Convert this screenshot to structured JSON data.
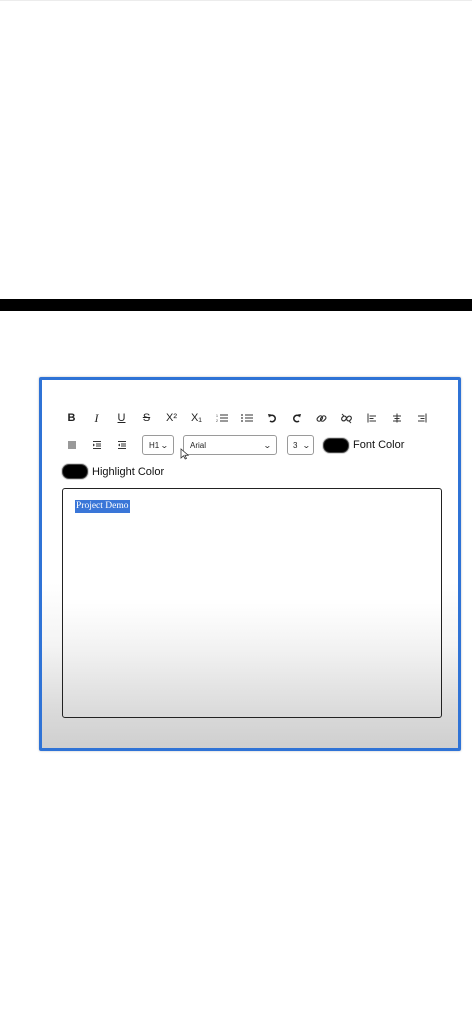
{
  "toolbar": {
    "row1": [
      {
        "name": "bold-button",
        "label": "B",
        "cls": "b"
      },
      {
        "name": "italic-button",
        "label": "I",
        "cls": "i"
      },
      {
        "name": "underline-button",
        "label": "U",
        "cls": "u"
      },
      {
        "name": "strikethrough-button",
        "label": "S",
        "cls": "s"
      },
      {
        "name": "superscript-button",
        "label": "X²"
      },
      {
        "name": "subscript-button",
        "label": "X₁"
      },
      {
        "name": "ordered-list-button",
        "icon": "ordered-list-icon"
      },
      {
        "name": "unordered-list-button",
        "icon": "unordered-list-icon"
      },
      {
        "name": "undo-button",
        "icon": "undo-icon"
      },
      {
        "name": "redo-button",
        "icon": "redo-icon"
      },
      {
        "name": "link-button",
        "icon": "link-icon"
      },
      {
        "name": "unlink-button",
        "icon": "unlink-icon"
      },
      {
        "name": "align-left-button",
        "icon": "align-left-icon"
      },
      {
        "name": "align-center-button",
        "icon": "align-center-icon"
      },
      {
        "name": "align-right-button",
        "icon": "align-right-icon"
      }
    ],
    "row2_buttons": [
      {
        "name": "justify-button",
        "icon": "justify-icon"
      },
      {
        "name": "indent-button",
        "icon": "indent-icon"
      },
      {
        "name": "outdent-button",
        "icon": "outdent-icon"
      }
    ],
    "heading_select": "H1",
    "font_select": "Arial",
    "size_select": "3",
    "font_color_label": "Font Color",
    "font_color": "#000000",
    "highlight_color_label": "Highlight Color",
    "highlight_color": "#000000"
  },
  "editor": {
    "content": "Project Demo"
  },
  "colors": {
    "frame_border": "#2f73d6",
    "selection": "#3a76d8"
  }
}
